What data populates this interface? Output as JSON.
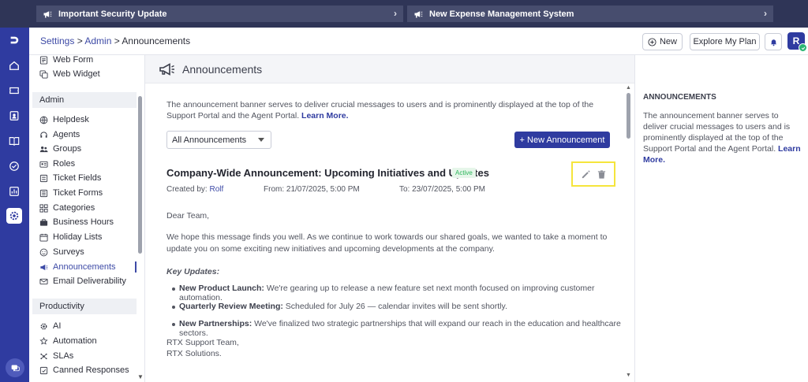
{
  "banners": [
    {
      "label": "Important Security Update"
    },
    {
      "label": "New Expense Management System"
    }
  ],
  "header": {
    "breadcrumb": {
      "settings": "Settings",
      "sep1": " > ",
      "admin": "Admin",
      "sep2": " > ",
      "current": "Announcements"
    },
    "new_label": "New",
    "explore_label": "Explore My Plan",
    "avatar_initial": "R"
  },
  "sidebar": {
    "top_items": [
      {
        "label": "Web Form",
        "icon": "form-icon"
      },
      {
        "label": "Web Widget",
        "icon": "widget-icon"
      }
    ],
    "admin_section": "Admin",
    "admin_items": [
      {
        "label": "Helpdesk",
        "icon": "globe-icon"
      },
      {
        "label": "Agents",
        "icon": "headset-icon"
      },
      {
        "label": "Groups",
        "icon": "groups-icon"
      },
      {
        "label": "Roles",
        "icon": "roles-icon"
      },
      {
        "label": "Ticket Fields",
        "icon": "ticket-fields-icon"
      },
      {
        "label": "Ticket Forms",
        "icon": "ticket-forms-icon"
      },
      {
        "label": "Categories",
        "icon": "categories-icon"
      },
      {
        "label": "Business Hours",
        "icon": "briefcase-icon"
      },
      {
        "label": "Holiday Lists",
        "icon": "calendar-icon"
      },
      {
        "label": "Surveys",
        "icon": "smiley-icon"
      },
      {
        "label": "Announcements",
        "icon": "megaphone-icon"
      },
      {
        "label": "Email Deliverability",
        "icon": "email-icon"
      }
    ],
    "productivity_section": "Productivity",
    "productivity_items": [
      {
        "label": "AI",
        "icon": "ai-icon"
      },
      {
        "label": "Automation",
        "icon": "automation-icon"
      },
      {
        "label": "SLAs",
        "icon": "sla-icon"
      },
      {
        "label": "Canned Responses",
        "icon": "canned-icon"
      }
    ]
  },
  "main": {
    "title": "Announcements",
    "intro": "The announcement banner serves to deliver crucial messages to users and is prominently displayed at the top of the Support Portal and the Agent Portal.",
    "learn_more": "Learn More.",
    "filter_value": "All Announcements",
    "new_announcement_label": "+ New Announcement",
    "announcement": {
      "title": "Company-Wide Announcement: Upcoming Initiatives and Updates",
      "status": "Active",
      "created_by_label": "Created by:",
      "created_by": "Rolf",
      "from": "From: 21/07/2025, 5:00 PM",
      "to": "To: 23/07/2025, 5:00 PM",
      "greeting": "Dear Team,",
      "paragraph": "We hope this message finds you well. As we continue to work towards our shared goals, we wanted to take a moment to update you on some exciting new initiatives and upcoming developments at the company.",
      "key_updates_label": "Key Updates:",
      "updates": [
        {
          "bold": "New Product Launch:",
          "text": " We're gearing up to release a new feature set next month focused on improving customer automation."
        },
        {
          "bold": "Quarterly Review Meeting:",
          "text": " Scheduled for July 26 — calendar invites will be sent shortly."
        },
        {
          "bold": "New Partnerships:",
          "text": " We've finalized two strategic partnerships that will expand our reach in the education and healthcare sectors."
        }
      ],
      "signoff_line1": "RTX Support Team,",
      "signoff_line2": "RTX Solutions."
    }
  },
  "right_panel": {
    "heading": "ANNOUNCEMENTS",
    "text": "The announcement banner serves to deliver crucial messages to users and is prominently displayed at the top of the Support Portal and the Agent Portal.",
    "learn_more": "Learn More."
  },
  "colors": {
    "topbar": "#2f3557",
    "rail": "#2f3ba0",
    "accent": "#2f3ba0",
    "highlight": "#f5e53c",
    "active_badge": "#2bb65a"
  }
}
